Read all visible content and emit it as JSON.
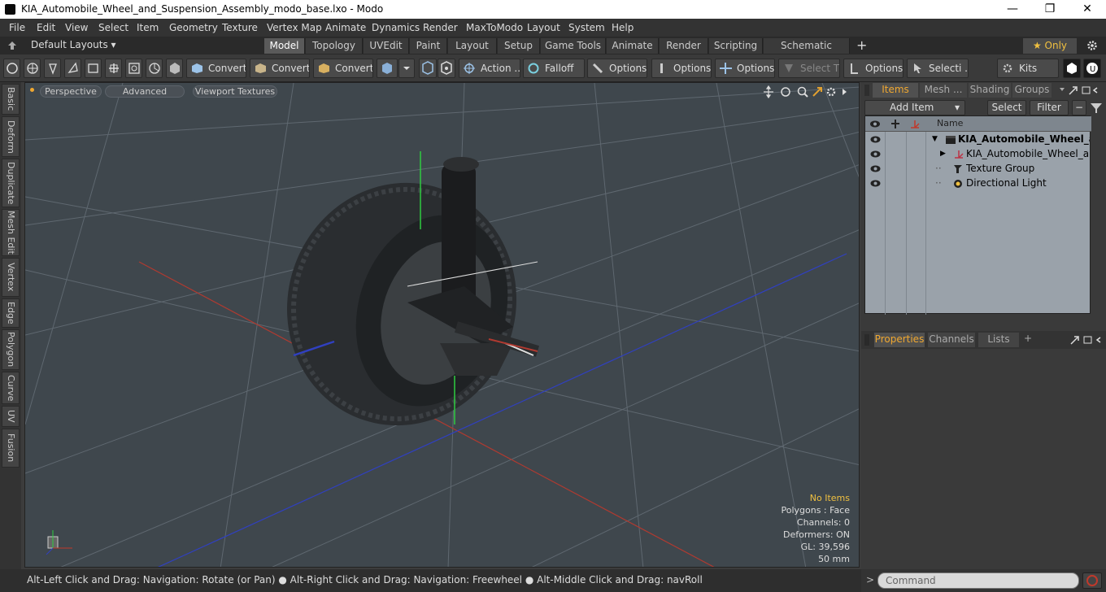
{
  "window": {
    "title": "KIA_Automobile_Wheel_and_Suspension_Assembly_modo_base.lxo - Modo",
    "minimize": "—",
    "maximize": "❐",
    "close": "✕"
  },
  "menu": [
    "File",
    "Edit",
    "View",
    "Select",
    "Item",
    "Geometry",
    "Texture",
    "Vertex Map",
    "Animate",
    "Dynamics",
    "Render",
    "MaxToModo",
    "Layout",
    "System",
    "Help"
  ],
  "layouts": {
    "label": "Default Layouts ▾"
  },
  "mode_tabs": [
    "Model",
    "Topology",
    "UVEdit",
    "Paint",
    "Layout",
    "Setup",
    "Game Tools",
    "Animate",
    "Render",
    "Scripting",
    "Schematic Fusion"
  ],
  "add_tab": "+",
  "only_btn": "★  Only",
  "toolbar": {
    "convert1": "Convert",
    "convert2": "Convert",
    "convert3": "Convert",
    "action": "Action",
    "action_more": "...",
    "falloff": "Falloff",
    "options1": "Options",
    "options2": "Options",
    "options3": "Options",
    "select_t": "Select T...",
    "options4": "Options",
    "selecti": "Selecti ...",
    "kits": "Kits"
  },
  "side_tabs": [
    "Basic",
    "Deform",
    "Duplicate",
    "Mesh Edit",
    "Vertex",
    "Edge",
    "Polygon",
    "Curve",
    "UV",
    "Fusion"
  ],
  "viewport": {
    "perspective": "Perspective",
    "advanced": "Advanced",
    "textures": "Viewport Textures",
    "stats": {
      "no_items": "No Items",
      "polygons": "Polygons : Face",
      "channels": "Channels: 0",
      "deformers": "Deformers: ON",
      "gl": "GL: 39,596",
      "size": "50 mm"
    }
  },
  "status": {
    "hint": "Alt-Left Click and Drag: Navigation: Rotate (or Pan) ● Alt-Right Click and Drag: Navigation: Freewheel ● Alt-Middle Click and Drag: navRoll"
  },
  "right": {
    "tabs": {
      "items": "Items",
      "mesh": "Mesh ...",
      "shading": "Shading",
      "groups": "Groups"
    },
    "add_item": "Add Item",
    "select": "Select",
    "filter": "Filter",
    "name_col": "Name",
    "rows": [
      {
        "label": "KIA_Automobile_Wheel_a..."
      },
      {
        "label": "KIA_Automobile_Wheel_and..."
      },
      {
        "label": "Texture Group"
      },
      {
        "label": "Directional Light"
      }
    ],
    "bottom_tabs": {
      "properties": "Properties",
      "channels": "Channels",
      "lists": "Lists",
      "add": "+"
    },
    "command_placeholder": "Command"
  },
  "colors": {
    "accent": "#f0a830",
    "viewport_bg": "#3f474d",
    "axis_x": "#c0392b",
    "axis_y": "#2ecc40",
    "axis_z": "#3448c8"
  }
}
